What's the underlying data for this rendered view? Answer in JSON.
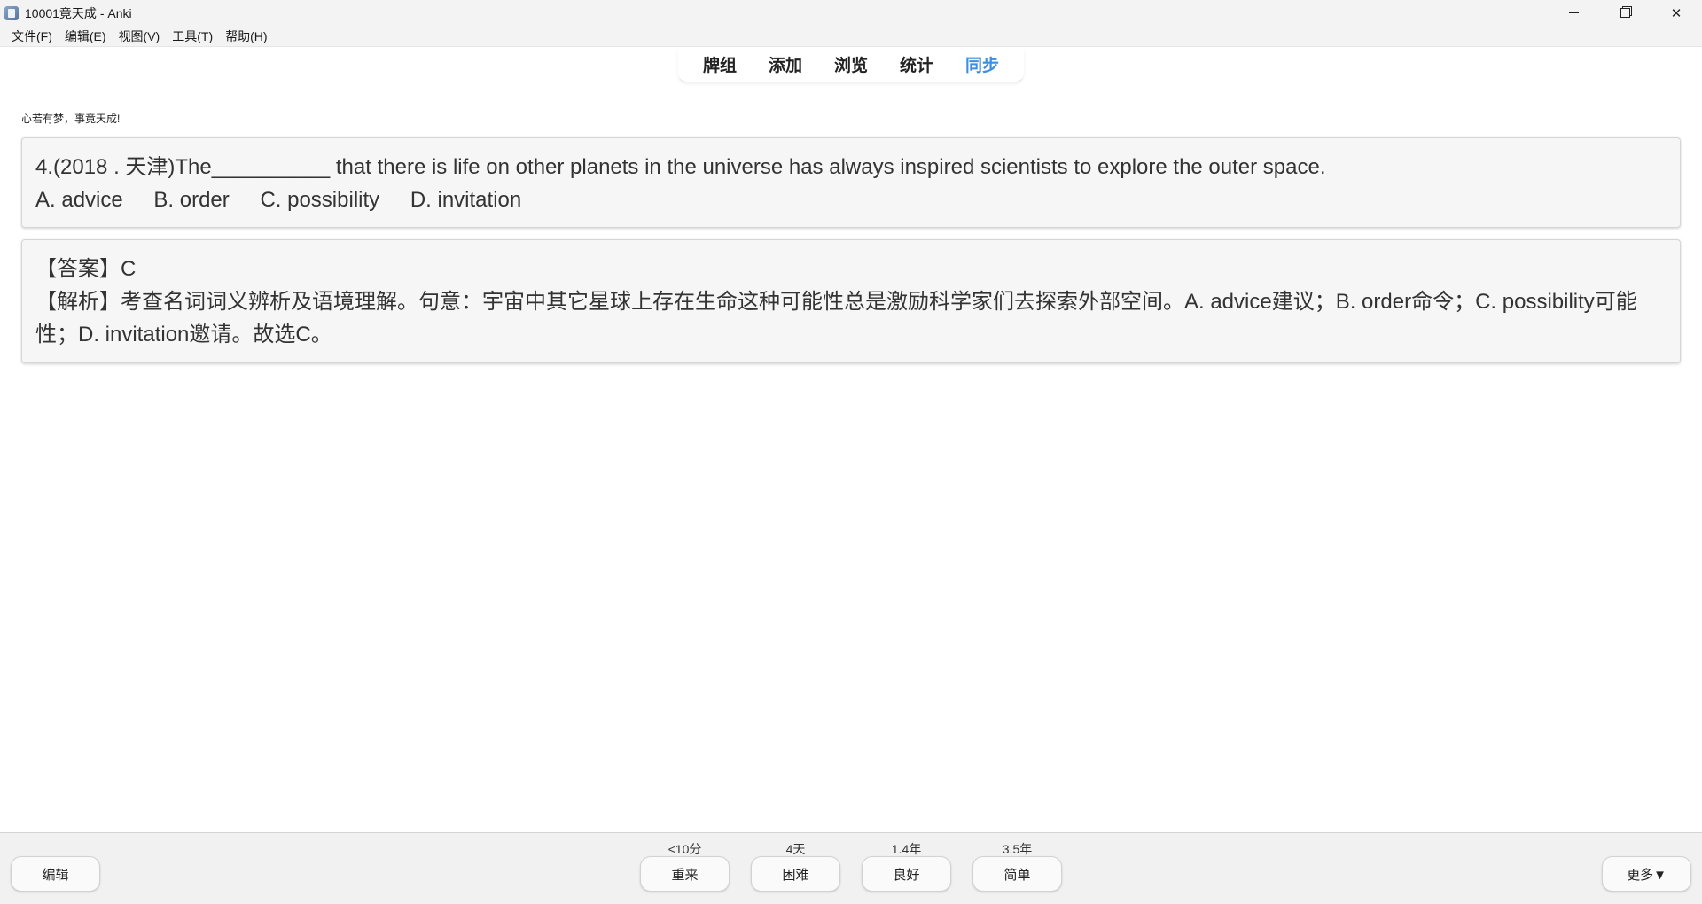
{
  "window": {
    "title": "10001竟天成 - Anki",
    "controls": {
      "minimize": "minimize",
      "restore": "restore",
      "close": "✕"
    }
  },
  "menu": [
    "文件(F)",
    "编辑(E)",
    "视图(V)",
    "工具(T)",
    "帮助(H)"
  ],
  "toolbar": {
    "tabs": [
      {
        "label": "牌组",
        "active": false
      },
      {
        "label": "添加",
        "active": false
      },
      {
        "label": "浏览",
        "active": false
      },
      {
        "label": "统计",
        "active": false
      },
      {
        "label": "同步",
        "active": true
      }
    ],
    "active_color": "#3d8ee0"
  },
  "deck_motto": "心若有梦，事竟天成!",
  "question": {
    "stem": "4.(2018 . 天津)The__________ that there is life on other planets in the universe has always inspired scientists to explore the outer space.",
    "options": [
      "A. advice",
      "B. order",
      "C. possibility",
      "D. invitation"
    ]
  },
  "answer": {
    "answer_line": "【答案】C",
    "explanation": "【解析】考查名词词义辨析及语境理解。句意：宇宙中其它星球上存在生命这种可能性总是激励科学家们去探索外部空间。A. advice建议；B. order命令；C. possibility可能性；D. invitation邀请。故选C。"
  },
  "bottom": {
    "edit_label": "编辑",
    "more_label": "更多▼",
    "buttons": [
      {
        "interval": "<10分",
        "label": "重来"
      },
      {
        "interval": "4天",
        "label": "困难"
      },
      {
        "interval": "1.4年",
        "label": "良好"
      },
      {
        "interval": "3.5年",
        "label": "简单"
      }
    ]
  }
}
